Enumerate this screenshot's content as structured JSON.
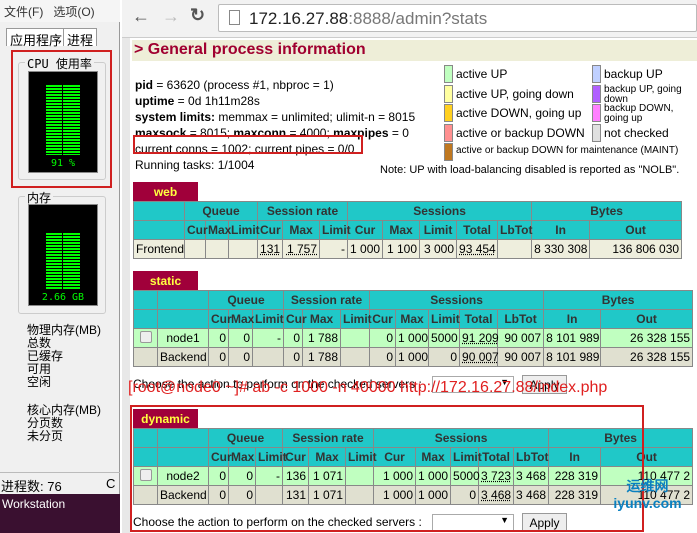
{
  "task_manager": {
    "menu": [
      "文件(F)",
      "选项(O)"
    ],
    "tabs": [
      "应用程序",
      "进程"
    ],
    "cpu_title": "CPU 使用率",
    "cpu_value": "91 %",
    "cpu_percent": 91,
    "mem_title": "内存",
    "mem_value": "2.66 GB",
    "mem_percent": 70,
    "phys_title": "物理内存(MB)",
    "phys_items": [
      "总数",
      "已缓存",
      "可用",
      "空闲"
    ],
    "kernel_title": "核心内存(MB)",
    "kernel_items": [
      "分页数",
      "未分页"
    ],
    "status": "进程数: 76",
    "status2": "C",
    "taskbar": "Workstation"
  },
  "browser": {
    "url_host": "172.16.27.88",
    "url_rest": ":8888/admin?stats"
  },
  "page": {
    "title": "> General process information",
    "info": [
      {
        "k": "pid",
        "v": " = 63620 (process #1, nbproc = 1)"
      },
      {
        "k": "uptime",
        "v": " = 0d 1h11m28s"
      },
      {
        "k": "system limits:",
        "v": " memmax = unlimited; ulimit-n = 8015"
      },
      {
        "k": "maxsock",
        "v": " = 8015; ",
        "k2": "maxconn",
        "v2": " = 4000; ",
        "k3": "maxpipes",
        "v3": " = 0"
      }
    ],
    "current": "current conns = 1002; current pipes = 0/0",
    "tasks": "Running tasks: 1/1004",
    "legend": [
      {
        "label": "active UP",
        "color": "#c0ffc0"
      },
      {
        "label": "active UP, going down",
        "color": "#ffffa0"
      },
      {
        "label": "active DOWN, going up",
        "color": "#ffd020"
      },
      {
        "label": "active or backup DOWN",
        "color": "#ff9090"
      },
      {
        "label": "active or backup DOWN for maintenance (MAINT)",
        "color": "#c07820"
      }
    ],
    "legend2": [
      {
        "label": "backup UP",
        "color": "#c0d0ff"
      },
      {
        "label": "backup UP, going down",
        "color": "#b060ff"
      },
      {
        "label": "backup DOWN, going up",
        "color": "#ff80ff"
      },
      {
        "label": "not checked",
        "color": "#e0e0e0"
      }
    ],
    "note": "Note: UP with load-balancing disabled is reported as \"NOLB\"."
  },
  "headers": {
    "groups": [
      "Queue",
      "Session rate",
      "Sessions",
      "Bytes"
    ],
    "sub": [
      "Cur",
      "Max",
      "Limit",
      "Cur",
      "Max",
      "Limit",
      "Cur",
      "Max",
      "Limit",
      "Total",
      "LbTot",
      "In",
      "Out"
    ]
  },
  "proxies": [
    {
      "name": "web",
      "checkbox": false,
      "rows": [
        {
          "type": "fe",
          "cells": [
            "Frontend",
            "",
            "",
            "",
            "131",
            "1 757",
            "-",
            "1 000",
            "1 100",
            "3 000",
            "93 454",
            "",
            "8 330 308",
            "136 806 030"
          ]
        }
      ]
    },
    {
      "name": "static",
      "checkbox": true,
      "rows": [
        {
          "type": "sv",
          "cells": [
            "node1",
            "0",
            "0",
            "-",
            "0",
            "1 788",
            "",
            "0",
            "1 000",
            "5000",
            "91 209",
            "90 007",
            "8 101 989",
            "26 328 155"
          ]
        },
        {
          "type": "be",
          "cells": [
            "Backend",
            "0",
            "0",
            "",
            "0",
            "1 788",
            "",
            "0",
            "1 000",
            "0",
            "90 007",
            "90 007",
            "8 101 989",
            "26 328 155"
          ]
        }
      ]
    },
    {
      "name": "dynamic",
      "checkbox": true,
      "rows": [
        {
          "type": "sv",
          "cells": [
            "node2",
            "0",
            "0",
            "-",
            "136",
            "1 071",
            "",
            "1 000",
            "1 000",
            "5000",
            "3 723",
            "3 468",
            "228 319",
            "110 477 2"
          ]
        },
        {
          "type": "be",
          "cells": [
            "Backend",
            "0",
            "0",
            "",
            "131",
            "1 071",
            "",
            "1 000",
            "1 000",
            "0",
            "3 468",
            "3 468",
            "228 319",
            "110 477 2"
          ]
        }
      ]
    }
  ],
  "action_label": "Choose the action to perform on the checked servers :",
  "apply": "Apply",
  "command": "[root@node0 ~]# ab -c 1000 -n 40000 http://172.16.27.88/index.php",
  "watermark": "运维网 iyunv.com"
}
